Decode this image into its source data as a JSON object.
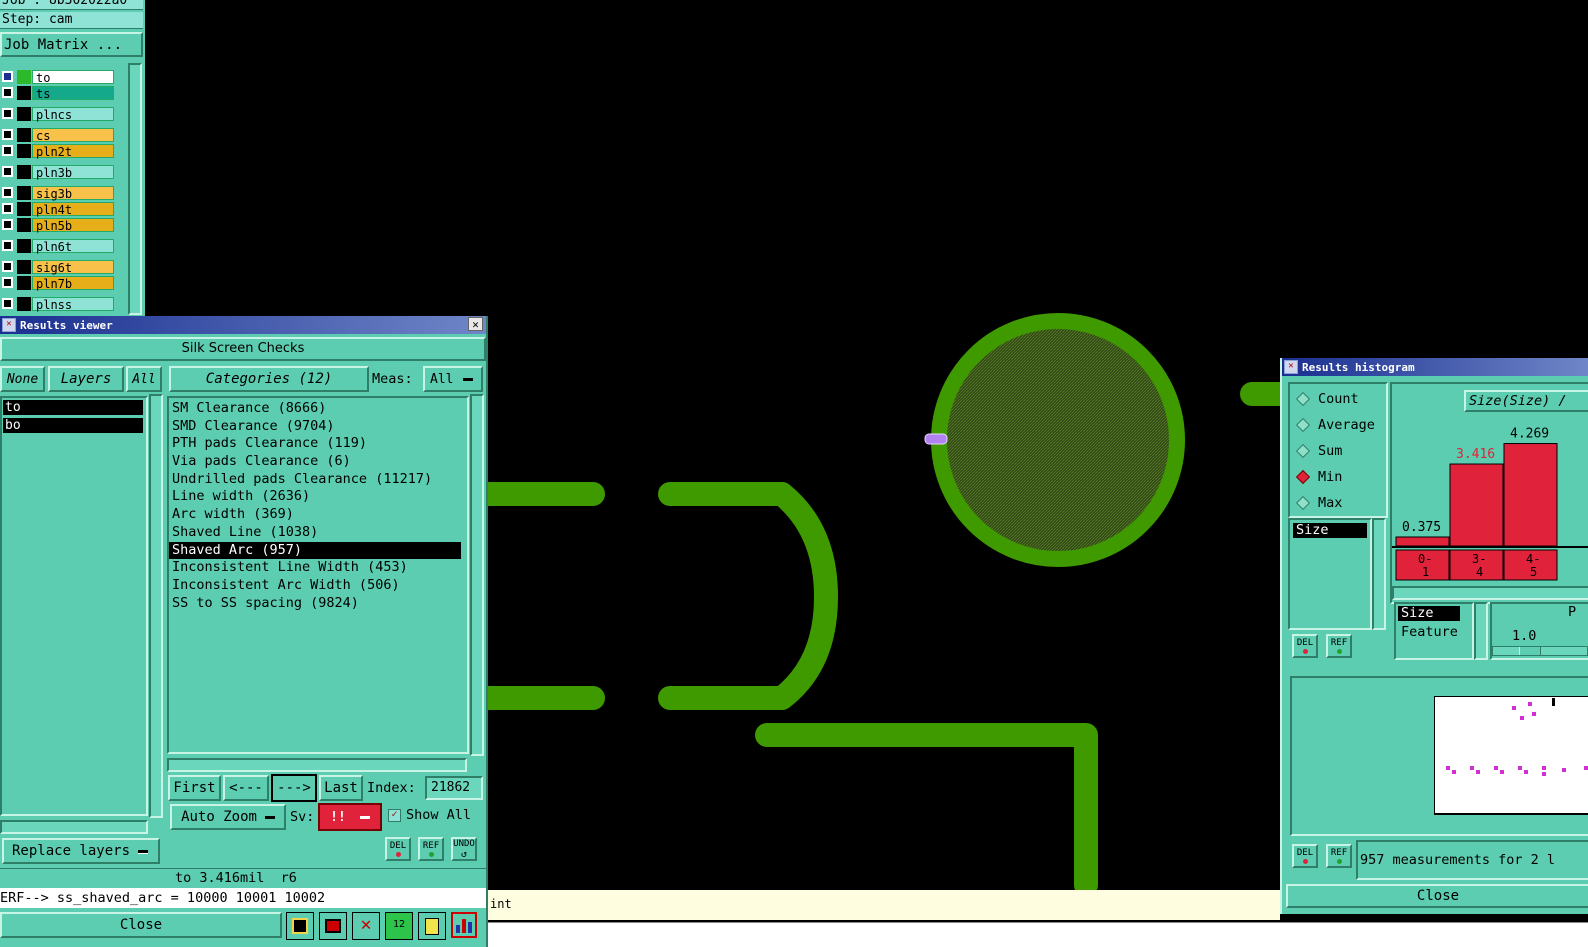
{
  "top_panel": {
    "job": "Job : 8b302022a0",
    "step": "Step: cam",
    "job_matrix": "Job Matrix ..."
  },
  "layers": [
    {
      "name": "to",
      "color": "#ffffff",
      "active": true
    },
    {
      "name": "ts",
      "color": "#13a98a"
    },
    {
      "name": "plncs",
      "color": "#8fe3d6"
    },
    {
      "name": "cs",
      "color": "#f7c14a"
    },
    {
      "name": "pln2t",
      "color": "#e6ae18"
    },
    {
      "name": "pln3b",
      "color": "#8fe3d6"
    },
    {
      "name": "sig3b",
      "color": "#f7c14a"
    },
    {
      "name": "pln4t",
      "color": "#e6ae18"
    },
    {
      "name": "pln5b",
      "color": "#e6ae18"
    },
    {
      "name": "pln6t",
      "color": "#8fe3d6"
    },
    {
      "name": "sig6t",
      "color": "#f7c14a"
    },
    {
      "name": "pln7b",
      "color": "#e6ae18"
    },
    {
      "name": "plnss",
      "color": "#8fe3d6"
    }
  ],
  "results_viewer": {
    "title": "Results viewer",
    "header": "Silk Screen Checks",
    "none_btn": "None",
    "layers_btn": "Layers",
    "all_btn": "All",
    "categories_btn": "Categories (12)",
    "meas_label": "Meas:",
    "meas_value": "All",
    "layer_list": [
      "to",
      "bo"
    ],
    "categories": [
      "SM Clearance (8666)",
      "SMD Clearance (9704)",
      "PTH pads Clearance (119)",
      "Via pads Clearance (6)",
      "Undrilled pads Clearance (11217)",
      "Line width (2636)",
      "Arc width (369)",
      "Shaved Line (1038)",
      "Shaved Arc (957)",
      "Inconsistent Line Width (453)",
      "Inconsistent Arc Width (506)",
      "SS to SS spacing (9824)"
    ],
    "selected_category": 8,
    "first_btn": "First",
    "prev_btn": "<---",
    "next_btn": "--->",
    "last_btn": "Last",
    "index_label": "Index:",
    "index_value": "21862",
    "auto_zoom": "Auto Zoom",
    "sv_label": "Sv:",
    "sv_value": "!!",
    "show_all": "Show All",
    "replace_layers": "Replace layers",
    "del_icon": "DEL",
    "ref_icon": "REF",
    "undo_icon": "UNDO",
    "status_line": "to 3.416mil  r6",
    "erf_line": "ERF--> ss_shaved_arc = 10000 10001 10002",
    "close_btn": "Close"
  },
  "results_histogram": {
    "title": "Results histogram",
    "modes": [
      "Count",
      "Average",
      "Sum",
      "Min",
      "Max"
    ],
    "selected_mode": "Min",
    "size_item": "Size",
    "dropdown": "Size(Size) /",
    "bars": [
      {
        "label": "0-\n1",
        "value": "0.375",
        "level": 0.375,
        "value_color": "#000000"
      },
      {
        "label": "3-\n4",
        "value": "3.416",
        "level": 3.416,
        "value_color": "#e0223a"
      },
      {
        "label": "4-\n5",
        "value": "4.269",
        "level": 4.269,
        "value_color": "#000000"
      }
    ],
    "axis_list": [
      "Size",
      "Feature"
    ],
    "scale_value": "1.0",
    "scale_right": "P",
    "measurements": "957 measurements for 2 l",
    "close_btn": "Close",
    "del_icon": "DEL",
    "ref_icon": "REF"
  },
  "status_bar": {
    "hint": "int"
  },
  "colors": {
    "panel": "#5ccdb0",
    "copper": "#3f9a00",
    "bar_red": "#e0223a",
    "selection": "#000000"
  }
}
